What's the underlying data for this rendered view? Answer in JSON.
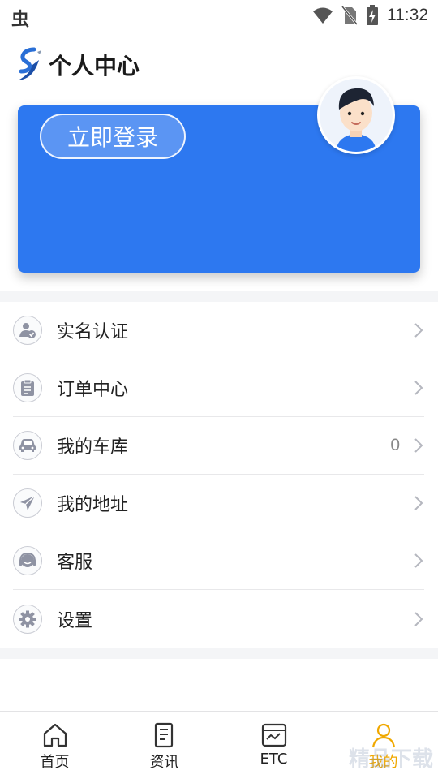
{
  "status_bar": {
    "app_icon": "虫",
    "time": "11:32"
  },
  "header": {
    "title": "个人中心"
  },
  "card": {
    "login_label": "立即登录"
  },
  "menu": {
    "items": [
      {
        "label": "实名认证",
        "icon": "user-verify-icon",
        "count": ""
      },
      {
        "label": "订单中心",
        "icon": "clipboard-icon",
        "count": ""
      },
      {
        "label": "我的车库",
        "icon": "car-icon",
        "count": "0"
      },
      {
        "label": "我的地址",
        "icon": "paper-plane-icon",
        "count": ""
      },
      {
        "label": "客服",
        "icon": "headset-icon",
        "count": ""
      },
      {
        "label": "设置",
        "icon": "gear-icon",
        "count": ""
      }
    ]
  },
  "bottom_nav": {
    "items": [
      {
        "label": "首页",
        "icon": "home-icon"
      },
      {
        "label": "资讯",
        "icon": "news-icon"
      },
      {
        "label": "ETC",
        "icon": "etc-card-icon"
      },
      {
        "label": "我的",
        "icon": "person-icon",
        "active": true
      }
    ]
  },
  "watermark": "精品下载",
  "colors": {
    "primary": "#2d78f0",
    "active_tab": "#f0a800",
    "band": "#f4f5f7"
  }
}
